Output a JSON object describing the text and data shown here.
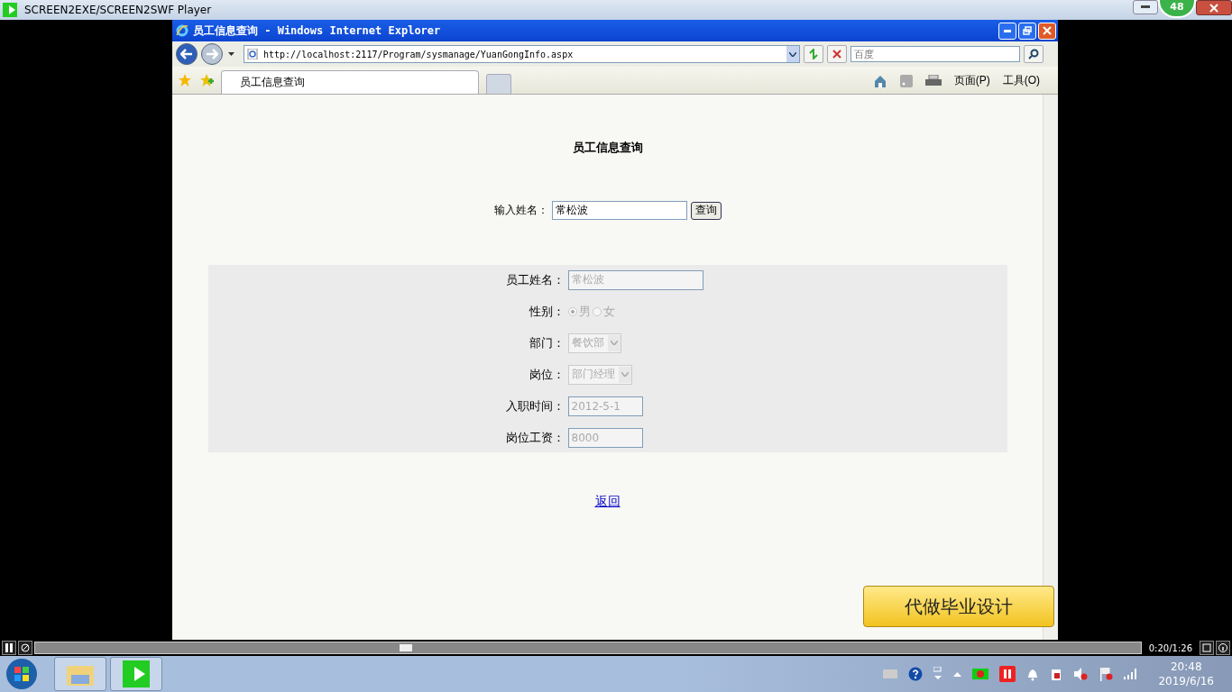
{
  "player": {
    "title": "SCREEN2EXE/SCREEN2SWF Player",
    "badge": "48",
    "time": "0:20/1:26",
    "level": 0.33
  },
  "browser": {
    "title": "员工信息查询 - Windows Internet Explorer",
    "url": "http://localhost:2117/Program/sysmanage/YuanGongInfo.aspx",
    "search_placeholder": "百度",
    "tabs": [
      {
        "label": "员工信息查询",
        "selected": true
      }
    ],
    "commands": [
      "页面(P)",
      "工具(O)"
    ]
  },
  "page": {
    "heading": "员工信息查询",
    "search": {
      "label": "输入姓名：",
      "value": "常松波",
      "button": "查询"
    },
    "details": [
      {
        "kind": "text",
        "label": "员工姓名：",
        "value": "常松波",
        "disabled": true
      },
      {
        "kind": "radio",
        "label": "性别：",
        "disabled": true,
        "options": [
          {
            "label": "男",
            "selected": true
          },
          {
            "label": "女",
            "selected": false
          }
        ]
      },
      {
        "kind": "select",
        "label": "部门：",
        "value": "餐饮部",
        "disabled": true
      },
      {
        "kind": "select",
        "label": "岗位：",
        "value": "部门经理",
        "disabled": true
      },
      {
        "kind": "text",
        "label": "入职时间：",
        "value": "2012-5-1",
        "disabled": true
      },
      {
        "kind": "text",
        "label": "岗位工资：",
        "value": "8000",
        "disabled": true
      }
    ],
    "back_link": "返回"
  },
  "callout": "代做毕业设计",
  "taskbar": {
    "time": "20:48",
    "date": "2019/6/16"
  }
}
